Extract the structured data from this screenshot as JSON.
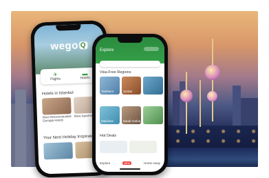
{
  "phone_left": {
    "logo": "wego",
    "logo_badge": "Q",
    "tiles": [
      {
        "label": "Flights",
        "icon": "airplane-icon"
      },
      {
        "label": "Hotels",
        "icon": "bed-icon"
      }
    ],
    "section_hotels": "Hotels in Istanbul",
    "hotel_cards": [
      {
        "title": "Most Recommended Georgia Hotels"
      },
      {
        "title": "Most Apartment"
      }
    ],
    "section_next": "Your Next Holiday Inspiration"
  },
  "phone_right": {
    "header_title": "Explore",
    "section_regions": "Visa-Free Regions",
    "regions_row1": [
      {
        "label": "Tashkent",
        "sub": ""
      },
      {
        "label": "Jordan",
        "sub": ""
      }
    ],
    "regions_row2": [
      {
        "label": "Maldives",
        "sub": ""
      },
      {
        "label": "Saudi Arabia",
        "sub": ""
      }
    ],
    "section_deals": "Hot Deals",
    "footer_left": "Explore",
    "footer_tag": "NEW",
    "footer_right": "Home Away"
  },
  "colors": {
    "brand_green": "#2b8a3e",
    "sky_top": "#e9b67a",
    "night_blue": "#1f2b55"
  }
}
